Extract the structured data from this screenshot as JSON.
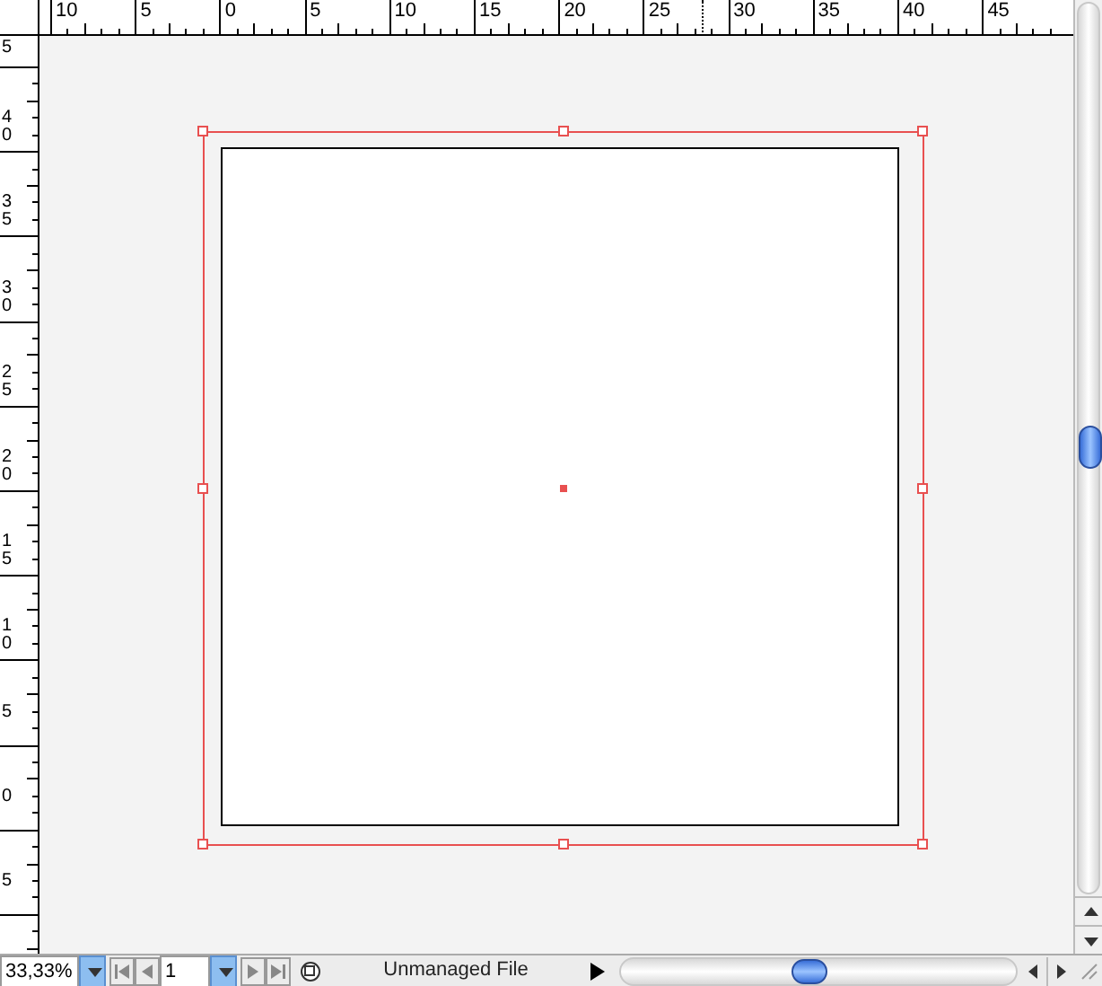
{
  "horizontal_ruler": {
    "labels": [
      "10",
      "5",
      "0",
      "5",
      "10",
      "15",
      "20",
      "25",
      "30",
      "35",
      "40",
      "45"
    ]
  },
  "vertical_ruler": {
    "labels": [
      "5",
      "40",
      "35",
      "30",
      "25",
      "20",
      "15",
      "10",
      "5",
      "0",
      "5"
    ]
  },
  "status_bar": {
    "zoom": "33,33%",
    "page": "1",
    "file_status": "Unmanaged File"
  }
}
